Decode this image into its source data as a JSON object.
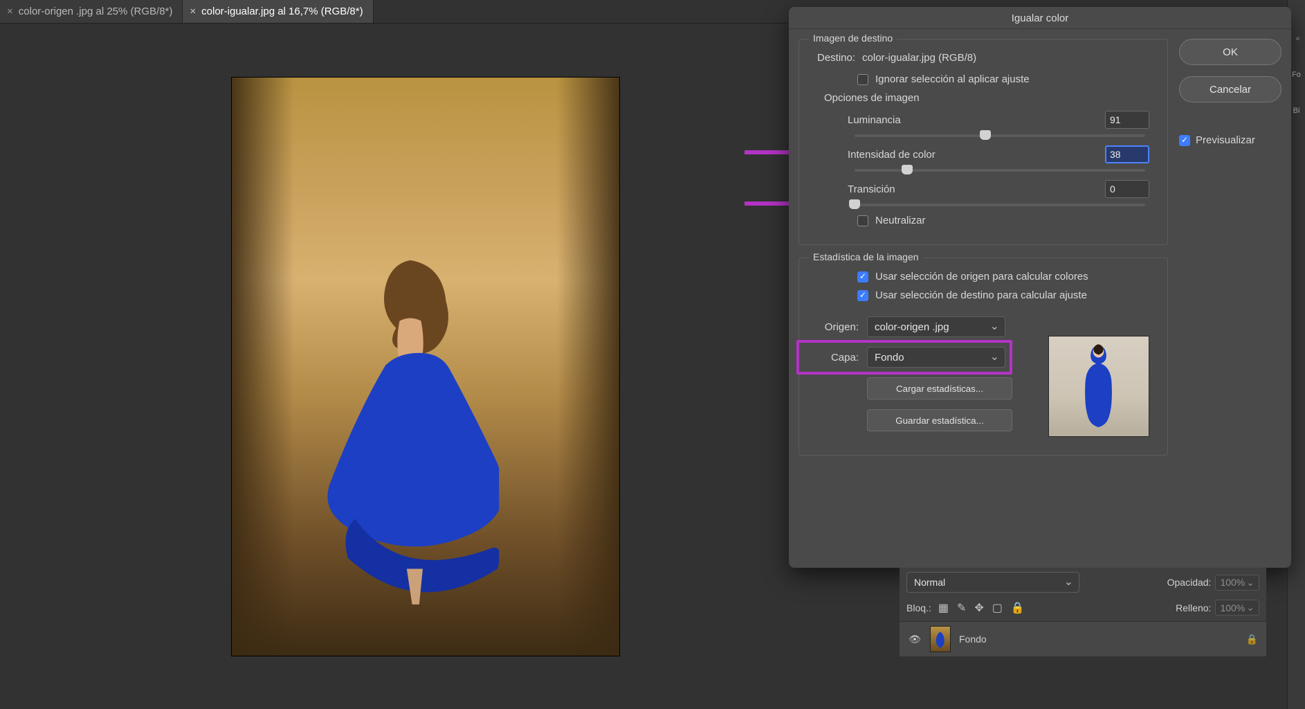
{
  "tabs": [
    {
      "label": "color-origen .jpg al 25% (RGB/8*)",
      "active": false
    },
    {
      "label": "color-igualar.jpg al 16,7% (RGB/8*)",
      "active": true
    }
  ],
  "right_strip": {
    "label1": "Fo",
    "label2": "Bi"
  },
  "dialog": {
    "title": "Igualar color",
    "buttons": {
      "ok": "OK",
      "cancel": "Cancelar"
    },
    "preview": {
      "label": "Previsualizar",
      "checked": true
    },
    "dest_section": {
      "legend": "Imagen de destino",
      "dest_label": "Destino:",
      "dest_value": "color-igualar.jpg (RGB/8)",
      "ignore_sel": {
        "label": "Ignorar selección al aplicar ajuste",
        "checked": false
      },
      "options_label": "Opciones de imagen",
      "luminance": {
        "label": "Luminancia",
        "value": "91",
        "pos": 45
      },
      "intensity": {
        "label": "Intensidad de color",
        "value": "38",
        "pos": 18,
        "selected": true
      },
      "fade": {
        "label": "Transición",
        "value": "0",
        "pos": 0
      },
      "neutralize": {
        "label": "Neutralizar",
        "checked": false
      }
    },
    "stats_section": {
      "legend": "Estadística de la imagen",
      "use_src_sel": {
        "label": "Usar selección de origen para calcular colores",
        "checked": true
      },
      "use_dst_sel": {
        "label": "Usar selección de destino para calcular ajuste",
        "checked": true
      },
      "source_label": "Origen:",
      "source_value": "color-origen .jpg",
      "layer_label": "Capa:",
      "layer_value": "Fondo",
      "load_btn": "Cargar estadísticas...",
      "save_btn": "Guardar estadística..."
    }
  },
  "layers": {
    "blend_label": "Normal",
    "opacity_label": "Opacidad:",
    "opacity_value": "100%",
    "lock_label": "Bloq.:",
    "fill_label": "Relleno:",
    "fill_value": "100%",
    "items": [
      {
        "name": "Fondo",
        "locked": true
      }
    ]
  },
  "colors": {
    "annotation": "#b433c6",
    "dress": "#1c3fc4"
  }
}
